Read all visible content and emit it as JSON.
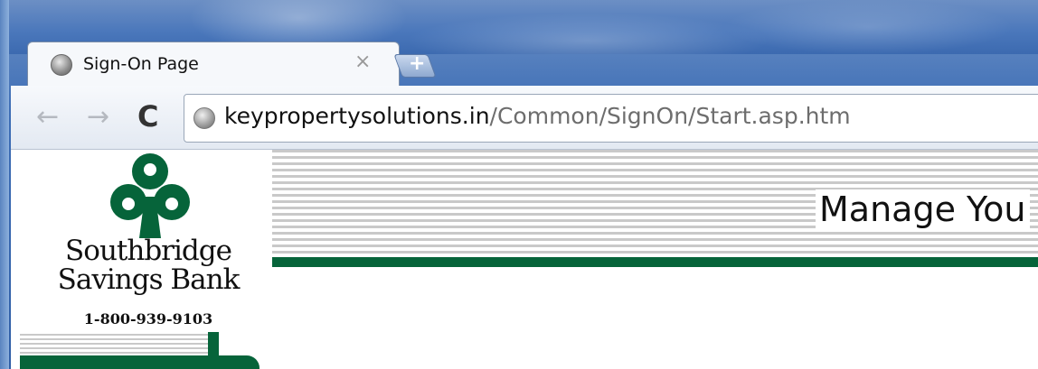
{
  "browser": {
    "tab_title": "Sign-On Page",
    "tab_close": "×",
    "new_tab": "+",
    "nav_back": "←",
    "nav_forward": "→",
    "nav_reload": "C",
    "url_host": "keypropertysolutions.in",
    "url_path": "/Common/SignOn/Start.asp.htm"
  },
  "page": {
    "bank_name_line1": "Southbridge",
    "bank_name_line2": "Savings Bank",
    "phone": "1-800-939-9103",
    "heading": "Manage You"
  },
  "colors": {
    "brand_green": "#06643a",
    "stripe_gray": "#c9c9c9"
  }
}
